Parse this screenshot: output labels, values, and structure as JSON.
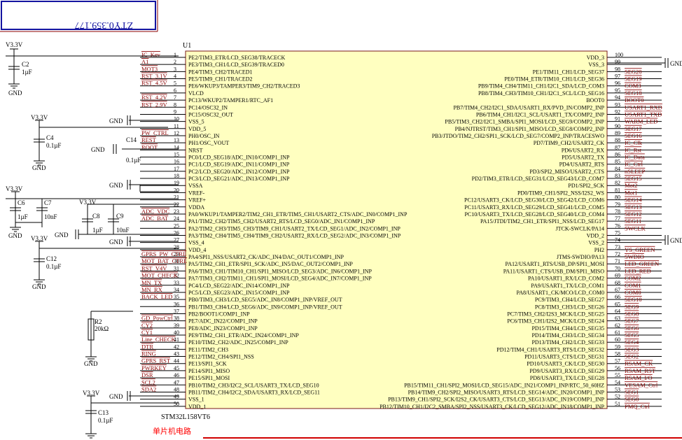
{
  "title_box": {
    "text": "ZTY0.359.177"
  },
  "chip": {
    "designator": "U1",
    "part": "STM32L158VT6",
    "caption": "单片机电路",
    "left_pins": [
      {
        "num": "1",
        "name": "PE2/TIM3_ETR/LCD_SEG38/TRACECK",
        "net": "IC_Kev"
      },
      {
        "num": "2",
        "name": "PE3/TIM3_CH1/LCD_SEG39/TRACED0",
        "net": "A1"
      },
      {
        "num": "3",
        "name": "PE4/TIM3_CH2/TRACED1",
        "net": "MOT3"
      },
      {
        "num": "4",
        "name": "PE5/TIM9_CH1/TRACED2",
        "net": "RST_3.1V"
      },
      {
        "num": "5",
        "name": "PE6/WKUP3/TAMPER3/TIM9_CH2/TRACED3",
        "net": "RST_4.5V"
      },
      {
        "num": "6",
        "name": "VLCD",
        "net": ""
      },
      {
        "num": "7",
        "name": "PC13/WKUP2/TAMPER1/RTC_AF1",
        "net": "RST_4.2V"
      },
      {
        "num": "8",
        "name": "PC14/OSC32_IN",
        "net": "RST_2.9V"
      },
      {
        "num": "9",
        "name": "PC15/OSC32_OUT",
        "net": ""
      },
      {
        "num": "10",
        "name": "VSS_5",
        "net": ""
      },
      {
        "num": "11",
        "name": "VDD_5",
        "net": ""
      },
      {
        "num": "12",
        "name": "PH0/OSC_IN",
        "net": "PW_CTRL"
      },
      {
        "num": "13",
        "name": "PH1/OSC_VOUT",
        "net": "REST"
      },
      {
        "num": "14",
        "name": "NRST",
        "net": "ROOT"
      },
      {
        "num": "15",
        "name": "PC0/LCD_SEG18/ADC_IN10/COMP1_INP",
        "net": ""
      },
      {
        "num": "16",
        "name": "PC1/LCD_SEG19/ADC_IN11/COMP1_INP",
        "net": ""
      },
      {
        "num": "17",
        "name": "PC2/LCD_SEG20/ADC_IN12/COMP1_INP",
        "net": ""
      },
      {
        "num": "18",
        "name": "PC3/LCD_SEG21/ADC_IN13/COMP1_INP",
        "net": ""
      },
      {
        "num": "19",
        "name": "VSSA",
        "net": ""
      },
      {
        "num": "20",
        "name": "VREF-",
        "net": ""
      },
      {
        "num": "21",
        "name": "VREF+",
        "net": ""
      },
      {
        "num": "22",
        "name": "VDDA",
        "net": ""
      },
      {
        "num": "23",
        "name": "PA0/WKUP1/TAMPER2/TIM2_CH1_ETR/TIM5_CH1/USART2_CTS/ADC_IN0/COMP1_INP",
        "net": "ADC_VDC"
      },
      {
        "num": "24",
        "name": "PA1/TIM2_CH2/TIM5_CH2/USART2_RTS/LCD_SEG0/ADC_IN1/COMP1_INP",
        "net": "ADC_BAT"
      },
      {
        "num": "25",
        "name": "PA2/TIM2_CH3/TIM5_CH3/TIM9_CH1/USART2_TX/LCD_SEG1/ADC_IN2/COMP1_INP",
        "net": ""
      },
      {
        "num": "26",
        "name": "PA3/TIM2_CH4/TIM5_CH4/TIM9_CH2/USART2_RX/LCD_SEG2/ADC_IN3/COMP1_INP",
        "net": ""
      },
      {
        "num": "27",
        "name": "VSS_4",
        "net": ""
      },
      {
        "num": "28",
        "name": "VDD_4",
        "net": ""
      },
      {
        "num": "29",
        "name": "PA4/SPI1_NSS/USART2_CK/ADC_IN4/DAC_OUT1/COMP1_INP",
        "net": "GPRS_PW_CTRL"
      },
      {
        "num": "30",
        "name": "PA5/TIM2_CH1_ETR/SPI1_SCK/ADC_IN5/DAC_OUT2/COMP1_INP",
        "net": "MOT_BAT_CTRL"
      },
      {
        "num": "31",
        "name": "PA6/TIM3_CH1/TIM10_CH1/SPI1_MISO/LCD_SEG3/ADC_IN6/COMP1_INP",
        "net": "RST_V4V"
      },
      {
        "num": "32",
        "name": "PA7/TIM3_CH2/TIM11_CH1/SPI1_MOSI/LCD_SEG4/ADC_IN7/COMP1_INP",
        "net": "MOT_CHECK"
      },
      {
        "num": "33",
        "name": "PC4/LCD_SEG22/ADC_IN14/COMP1_INP",
        "net": "MN_TX"
      },
      {
        "num": "34",
        "name": "PC5/LCD_SEG23/ADC_IN15/COMP1_INP",
        "net": "MN_RX"
      },
      {
        "num": "35",
        "name": "PB0/TIM3_CH3/LCD_SEG5/ADC_IN8/COMP1_INP/VREF_OUT",
        "net": "BACK_LED"
      },
      {
        "num": "36",
        "name": "PB1/TIM3_CH4/LCD_SEG6/ADC_IN9/COMP1_INP/VREF_OUT",
        "net": ""
      },
      {
        "num": "37",
        "name": "PB2/BOOT1/COMP1_INP",
        "net": ""
      },
      {
        "num": "38",
        "name": "PE7/ADC_IN22/COMP1_INP",
        "net": "GD_PowCtrl"
      },
      {
        "num": "39",
        "name": "PE8/ADC_IN23/COMP1_INP",
        "net": "CY2"
      },
      {
        "num": "40",
        "name": "PE9/TIM2_CH1_ETR/ADC_IN24/COMP1_INP",
        "net": "CY1"
      },
      {
        "num": "41",
        "name": "PE10/TIM2_CH2/ADC_IN25/COMP1_INP",
        "net": "Line_CHECK"
      },
      {
        "num": "42",
        "name": "PE11/TIM2_CH3",
        "net": "DTR"
      },
      {
        "num": "43",
        "name": "PE12/TIM2_CH4/SPI1_NSS",
        "net": "RING"
      },
      {
        "num": "44",
        "name": "PE13/SPI1_SCK",
        "net": "GPRS_RST"
      },
      {
        "num": "45",
        "name": "PE14/SPI1_MISO",
        "net": "PWRKEY"
      },
      {
        "num": "46",
        "name": "PE15/SPI1_MOSI",
        "net": "DSR"
      },
      {
        "num": "47",
        "name": "PB10/TIM2_CH3/I2C2_SCL/USART3_TX/LCD_SEG10",
        "net": "SCL2"
      },
      {
        "num": "48",
        "name": "PB11/TIM2_CH4/I2C2_SDA/USART3_RX/LCD_SEG11",
        "net": "SDA2"
      },
      {
        "num": "49",
        "name": "VSS_1",
        "net": ""
      },
      {
        "num": "50",
        "name": "VDD_1",
        "net": ""
      }
    ],
    "right_pins": [
      {
        "num": "100",
        "name": "VDD_3",
        "net": ""
      },
      {
        "num": "99",
        "name": "VSS_3",
        "net": ""
      },
      {
        "num": "98",
        "name": "PE1/TIM11_CH1/LCD_SEG37",
        "net": "SEG20"
      },
      {
        "num": "97",
        "name": "PE0/TIM4_ETR/TIM10_CH1/LCD_SEG36",
        "net": "SEG19"
      },
      {
        "num": "96",
        "name": "PB9/TIM4_CH4/TIM11_CH1/I2C1_SDA/LCD_COM3",
        "net": "COM3"
      },
      {
        "num": "95",
        "name": "PB8/TIM4_CH3/TIM10_CH1/I2C1_SCL/LCD_SEG16",
        "net": "SEG18"
      },
      {
        "num": "94",
        "name": "BOOT0",
        "net": "BOOT0"
      },
      {
        "num": "93",
        "name": "PB7/TIM4_CH2/I2C1_SDA/USART1_RX/PVD_IN/COMP2_INP",
        "net": "USART1_RXD"
      },
      {
        "num": "92",
        "name": "PB6/TIM4_CH1/I2C1_SCL/USART1_TX/COMP2_INP",
        "net": "USART1_TXD"
      },
      {
        "num": "91",
        "name": "PB5/TIM3_CH2/I2C1_SMBA/SPI1_MOSI/LCD_SEG9/COMP2_INP",
        "net": "WARM_LED"
      },
      {
        "num": "90",
        "name": "PB4/NJTRST/TIM3_CH1/SPI1_MISO/LCD_SEG8/COMP2_INP",
        "net": "SEG17"
      },
      {
        "num": "89",
        "name": "PB3/JTDO/TIM2_CH2/SPI1_SCK/LCD_SEG7/COMP2_INP/TRACESWO",
        "net": "SEG16"
      },
      {
        "num": "88",
        "name": "PD7/TIM9_CH2/USART2_CK",
        "net": "IC_Clk"
      },
      {
        "num": "87",
        "name": "PD6/USART2_RX",
        "net": "IC_Rst"
      },
      {
        "num": "86",
        "name": "PD5/USART2_TX",
        "net": "IC_Data"
      },
      {
        "num": "85",
        "name": "PD4/USART2_RTS",
        "net": "IC_Ctrl"
      },
      {
        "num": "84",
        "name": "PD3/SPI2_MISO/USART2_CTS",
        "net": "nSLEEP"
      },
      {
        "num": "83",
        "name": "PD2/TIM3_ETR/LCD_SEG31/LCD_SEG43/LCD_COM7",
        "net": "SEG15"
      },
      {
        "num": "82",
        "name": "PD1/SPI2_SCK",
        "net": "Mot2"
      },
      {
        "num": "81",
        "name": "PD0/TIM9_CH1/SPI2_NSS/I2S2_WS",
        "net": "Mot1"
      },
      {
        "num": "80",
        "name": "PC12/USART3_CK/LCD_SEG30/LCD_SEG42/LCD_COM6",
        "net": "SEG14"
      },
      {
        "num": "79",
        "name": "PC11/USART3_RX/LCD_SEG29/LCD_SEG41/LCD_COM5",
        "net": "SEG13"
      },
      {
        "num": "78",
        "name": "PC10/USART3_TX/LCD_SEG28/LCD_SEG40/LCD_COM4",
        "net": "SEG12"
      },
      {
        "num": "77",
        "name": "PA15/JTDI/TIM2_CH1_ETR/SPI1_NSS/LCD_SEG17",
        "net": "SEG11"
      },
      {
        "num": "76",
        "name": "JTCK-SWCLK/PA14",
        "net": "SWCLK"
      },
      {
        "num": "75",
        "name": "VDD_2",
        "net": ""
      },
      {
        "num": "74",
        "name": "VSS_2",
        "net": ""
      },
      {
        "num": "73",
        "name": "PH2",
        "net": "YS_GREEN"
      },
      {
        "num": "72",
        "name": "JTMS-SWDIO/PA13",
        "net": "SWDIO"
      },
      {
        "num": "71",
        "name": "PA12/USART1_RTS/USB_DP/SPI1_MOSI",
        "net": "LED_GREEN"
      },
      {
        "num": "70",
        "name": "PA11/USART1_CTS/USB_DM/SPI1_MISO",
        "net": "LED_RED"
      },
      {
        "num": "69",
        "name": "PA10/USART1_RX/LCD_COM2",
        "net": "COM2"
      },
      {
        "num": "68",
        "name": "PA9/USART1_TX/LCD_COM1",
        "net": "COM1"
      },
      {
        "num": "67",
        "name": "PA8/USART1_CK/MCO/LCD_COM0",
        "net": "COM0"
      },
      {
        "num": "66",
        "name": "PC9/TIM3_CH4/LCD_SEG27",
        "net": "SEG10"
      },
      {
        "num": "65",
        "name": "PC8/TIM3_CH3/LCD_SEG26",
        "net": "SEG9"
      },
      {
        "num": "64",
        "name": "PC7/TIM3_CH2/I2S3_MCK/LCD_SEG25",
        "net": "SEG8"
      },
      {
        "num": "63",
        "name": "PC6/TIM3_CH1/I2S2_MCK/LCD_SEG24",
        "net": "SEG7"
      },
      {
        "num": "62",
        "name": "PD15/TIM4_CH4/LCD_SEG35",
        "net": "SEG6"
      },
      {
        "num": "61",
        "name": "PD14/TIM4_CH3/LCD_SEG34",
        "net": "SEG5"
      },
      {
        "num": "60",
        "name": "PD13/TIM4_CH2/LCD_SEG33",
        "net": "SEG4"
      },
      {
        "num": "59",
        "name": "PD12/TIM4_CH1/USART3_RTS/LCD_SEG32",
        "net": "SEG3"
      },
      {
        "num": "58",
        "name": "PD11/USART3_CTS/LCD_SEG31",
        "net": "SEG2"
      },
      {
        "num": "57",
        "name": "PD10/USART3_CK/LCD_SEG30",
        "net": "RSAM_CK"
      },
      {
        "num": "56",
        "name": "PD9/USART3_RX/LCD_SEG29",
        "net": "RSAM_RST"
      },
      {
        "num": "55",
        "name": "PD8/USART3_TX/LCD_SEG28",
        "net": "RSAM_I/O"
      },
      {
        "num": "54",
        "name": "PB15/TIM11_CH1/SPI2_MOSI/LCD_SEG15/ADC_IN21/COMP1_INP/RTC_50_60HZ",
        "net": "VESAM_Ctrl"
      },
      {
        "num": "53",
        "name": "PB14/TIM9_CH2/SPI2_MISO/USART3_RTS/LCD_SEG14/ADC_IN20/COMP1_INP",
        "net": "SEG1"
      },
      {
        "num": "52",
        "name": "PB13/TIM9_CH1/SPI2_SCK/I2S2_CK/USART3_CTS/LCD_SEG13/ADC_IN19/COMP1_INP",
        "net": "SEG0"
      },
      {
        "num": "51",
        "name": "PB12/TIM10_CH1/I2C2_SMBA/SPI2_NSS/USART3_CK/LCD_SEG12/ADC_IN18/COMP1_INP",
        "net": "PMQ_Ctrl"
      }
    ]
  },
  "labels": {
    "v33": "V3.3V",
    "gnd": "GND",
    "c2": "C2",
    "c2v": "1µF",
    "c4": "C4",
    "c4v": "0.1µF",
    "c14": "C14",
    "c14v": "0.1µF",
    "c6": "C6",
    "c6v": "1µF",
    "c7": "C7",
    "c7v": "10nF",
    "c8": "C8",
    "c8v": "1µF",
    "c9": "C9",
    "c9v": "10nF",
    "c12": "C12",
    "c12v": "0.1µF",
    "r2": "R2",
    "r2v": "20kΩ",
    "c13": "C13",
    "c13v": "0.1µF"
  },
  "colors": {
    "chip_fill": "#ffffc0",
    "chip_stroke": "#7a1a1a",
    "wire": "#000000",
    "net_text": "#8b0000",
    "pin_text": "#000000",
    "part_text": "#00008b",
    "caption": "#ff0000",
    "title_border": "#1414a0"
  }
}
